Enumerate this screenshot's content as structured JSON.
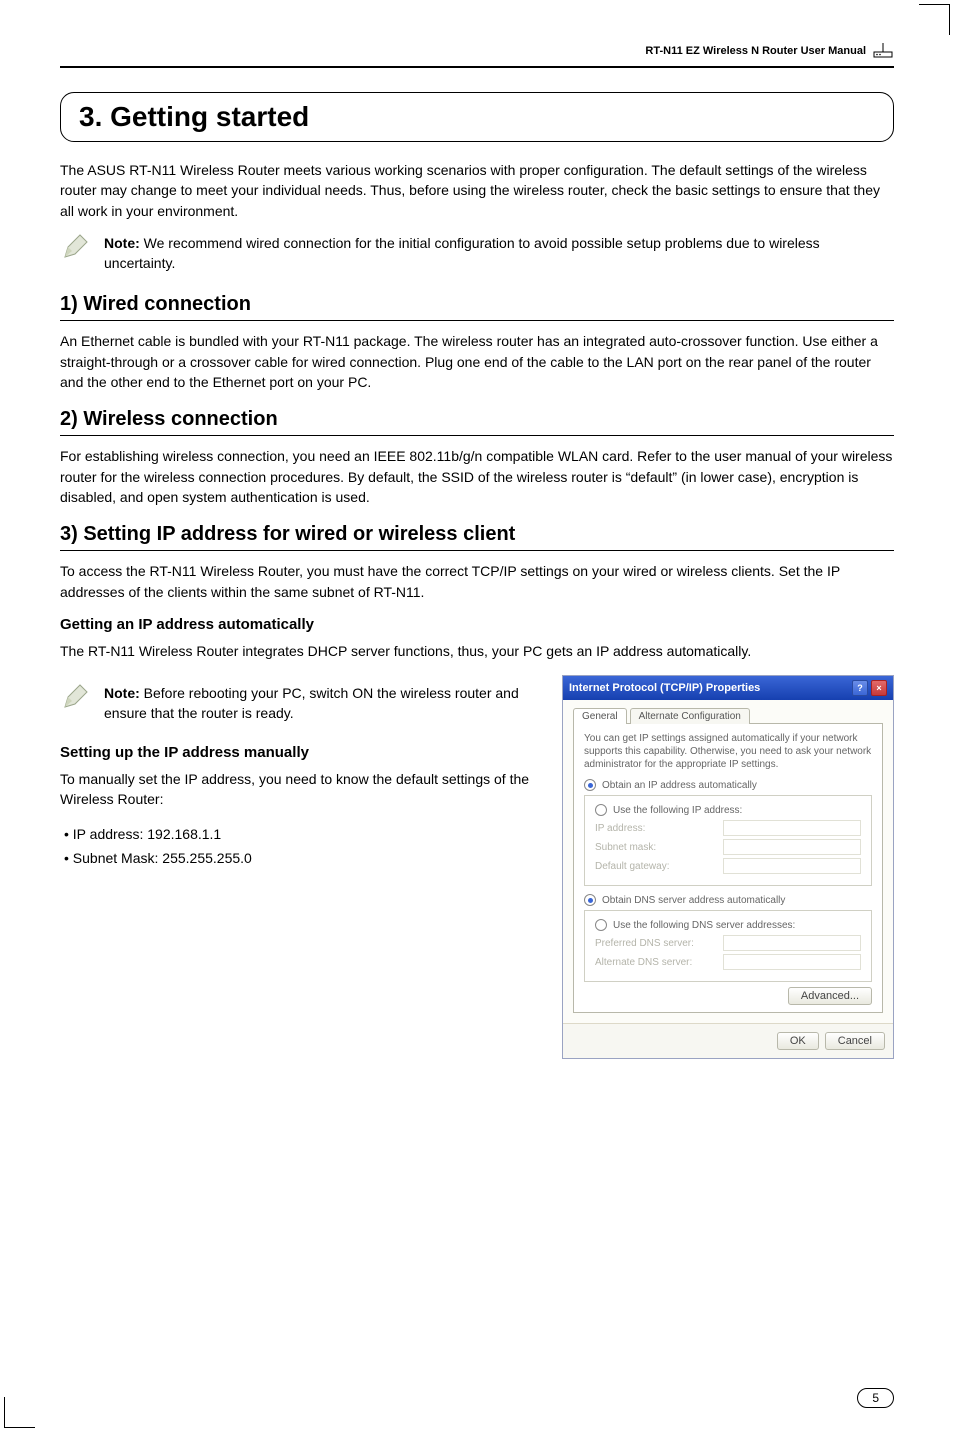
{
  "header": {
    "product_label": "RT-N11 EZ Wireless N Router User Manual"
  },
  "chapter": {
    "title": "3. Getting started"
  },
  "intro": {
    "p1": "The ASUS RT-N11 Wireless Router meets various working scenarios with proper configuration. The default settings of the wireless router may change to meet your individual needs. Thus, before using the wireless router, check the basic settings to ensure that they all work in your environment."
  },
  "note1": {
    "label": "Note:",
    "text": " We recommend wired connection for the initial configuration to avoid possible setup problems due to wireless uncertainty."
  },
  "s1": {
    "title": "1) Wired connection",
    "body": "An Ethernet cable is bundled with your RT-N11 package. The wireless router has an integrated auto-crossover function. Use either a straight-through or a crossover cable for wired connection. Plug one end of the cable to the LAN port on the rear panel of the router and the other end to the Ethernet port on your PC."
  },
  "s2": {
    "title": "2) Wireless connection",
    "body": "For establishing wireless connection, you need an IEEE 802.11b/g/n compatible WLAN card. Refer to the user manual of your wireless router for the wireless connection procedures. By default, the SSID of the wireless router is “default” (in lower case), encryption is disabled, and open system authentication is used."
  },
  "s3": {
    "title": "3) Setting IP address for wired or wireless client",
    "body": "To access the RT-N11 Wireless Router, you must have the correct TCP/IP settings on your wired or wireless clients. Set the IP addresses of the clients within the same subnet of RT-N11."
  },
  "s3a": {
    "title": "Getting an IP address automatically",
    "body": "The RT-N11 Wireless Router integrates DHCP server functions, thus, your PC gets an IP address automatically."
  },
  "note2": {
    "label": "Note:",
    "text": " Before rebooting your PC, switch ON the wireless router and ensure that the router is ready."
  },
  "s3b": {
    "title": "Setting up the IP address manually",
    "body": "To manually set the IP address, you need to know the default settings of the Wireless Router:",
    "bullets": [
      "IP address: 192.168.1.1",
      "Subnet Mask: 255.255.255.0"
    ]
  },
  "dialog": {
    "title": "Internet Protocol (TCP/IP) Properties",
    "tab_general": "General",
    "tab_alt": "Alternate Configuration",
    "description": "You can get IP settings assigned automatically if your network supports this capability. Otherwise, you need to ask your network administrator for the appropriate IP settings.",
    "radio_ip_auto": "Obtain an IP address automatically",
    "radio_ip_manual": "Use the following IP address:",
    "lbl_ip": "IP address:",
    "lbl_mask": "Subnet mask:",
    "lbl_gw": "Default gateway:",
    "radio_dns_auto": "Obtain DNS server address automatically",
    "radio_dns_manual": "Use the following DNS server addresses:",
    "lbl_dns1": "Preferred DNS server:",
    "lbl_dns2": "Alternate DNS server:",
    "btn_adv": "Advanced...",
    "btn_ok": "OK",
    "btn_cancel": "Cancel"
  },
  "footer": {
    "page": "5"
  }
}
